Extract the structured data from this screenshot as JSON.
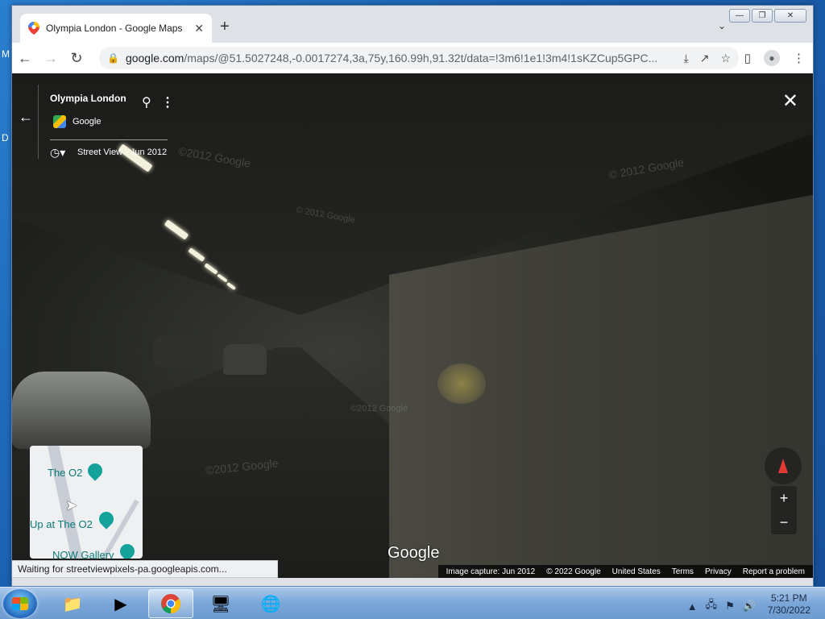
{
  "desktop": {
    "letters": [
      "M",
      "D"
    ]
  },
  "browser": {
    "tab_title": "Olympia London - Google Maps",
    "url_host": "google.com",
    "url_path": "/maps/@51.5027248,-0.0017274,3a,75y,160.99h,91.32t/data=!3m6!1e1!3m4!1sKZCup5GPC...",
    "window_controls": {
      "minimize": "—",
      "restore": "❐",
      "close": "✕"
    }
  },
  "streetview": {
    "place_title": "Olympia London",
    "provider": "Google",
    "history_label": "Street View - Jun 2012",
    "watermarks": [
      "©2012 Google",
      "© 2012 Google",
      "© 2012 Google",
      "©2012 Google",
      "©2012 Google"
    ],
    "google_logo": "Google"
  },
  "minimap": {
    "labels": [
      "The O2",
      "Up at The O2",
      "NOW Gallery"
    ],
    "accent": "#15a29b"
  },
  "footer": {
    "image_capture": "Image capture: Jun 2012",
    "copyright": "© 2022 Google",
    "region": "United States",
    "terms": "Terms",
    "privacy": "Privacy",
    "report": "Report a problem"
  },
  "status": {
    "text": "Waiting for streetviewpixels-pa.googleapis.com..."
  },
  "taskbar": {
    "time": "5:21 PM",
    "date": "7/30/2022",
    "apps": [
      "file-explorer",
      "media-player",
      "chrome",
      "control-panel",
      "network-tool"
    ]
  }
}
